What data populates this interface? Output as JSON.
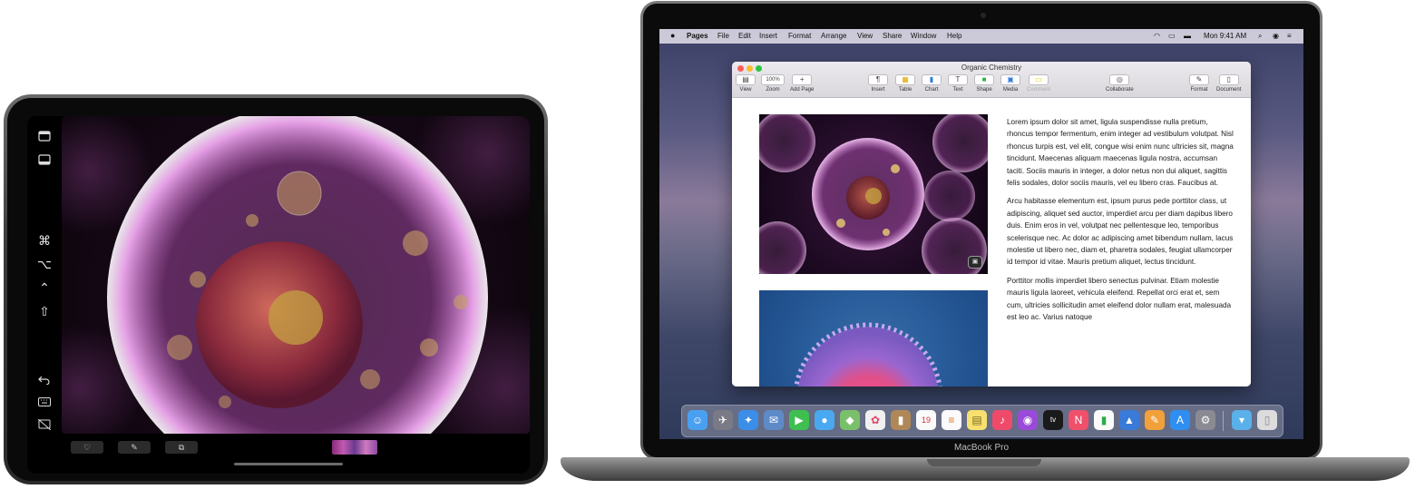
{
  "ipad": {
    "sidecar_buttons": [
      "⌘",
      "⌥",
      "⌃",
      "⇧"
    ],
    "touchbar_keys": [
      "♡",
      "✎",
      "⧉"
    ]
  },
  "mac": {
    "brand_label": "MacBook Pro",
    "menubar": {
      "app_name": "Pages",
      "items": [
        "File",
        "Edit",
        "Insert",
        "Format",
        "Arrange",
        "View",
        "Share",
        "Window",
        "Help"
      ],
      "clock": "Mon 9:41 AM"
    },
    "window": {
      "title": "Organic Chemistry",
      "zoom_value": "100%",
      "toolbar": [
        {
          "label": "View",
          "glyph": "▤"
        },
        {
          "label": "Zoom",
          "glyph": "100%"
        },
        {
          "label": "Add Page",
          "glyph": "+"
        },
        {
          "label": "Insert",
          "glyph": "¶"
        },
        {
          "label": "Table",
          "glyph": "▦"
        },
        {
          "label": "Chart",
          "glyph": "▮"
        },
        {
          "label": "Text",
          "glyph": "T"
        },
        {
          "label": "Shape",
          "glyph": "■"
        },
        {
          "label": "Media",
          "glyph": "▣"
        },
        {
          "label": "Comment",
          "glyph": "▭"
        },
        {
          "label": "Collaborate",
          "glyph": "◎"
        },
        {
          "label": "Format",
          "glyph": "✎"
        },
        {
          "label": "Document",
          "glyph": "▯"
        }
      ],
      "paragraphs": [
        "Lorem ipsum dolor sit amet, ligula suspendisse nulla pretium, rhoncus tempor fermentum, enim integer ad vestibulum volutpat. Nisl rhoncus turpis est, vel elit, congue wisi enim nunc ultricies sit, magna tincidunt. Maecenas aliquam maecenas ligula nostra, accumsan taciti. Sociis mauris in integer, a dolor netus non dui aliquet, sagittis felis sodales, dolor sociis mauris, vel eu libero cras. Faucibus at.",
        "Arcu habitasse elementum est, ipsum purus pede porttitor class, ut adipiscing, aliquet sed auctor, imperdiet arcu per diam dapibus libero duis. Enim eros in vel, volutpat nec pellentesque leo, temporibus scelerisque nec. Ac dolor ac adipiscing amet bibendum nullam, lacus molestie ut libero nec, diam et, pharetra sodales, feugiat ullamcorper id tempor id vitae. Mauris pretium aliquet, lectus tincidunt.",
        "Porttitor mollis imperdiet libero senectus pulvinar. Etiam molestie mauris ligula laoreet, vehicula eleifend. Repellat orci erat et, sem cum, ultricies sollicitudin amet eleifend dolor nullam erat, malesuada est leo ac. Varius natoque"
      ]
    },
    "dock_icons": [
      "finder-icon",
      "launchpad-icon",
      "safari-icon",
      "photos-browser-icon",
      "facetime-icon",
      "messages-icon",
      "maps-icon",
      "photos-icon",
      "contacts-icon",
      "calendar-icon",
      "reminders-icon",
      "notes-icon",
      "music-icon",
      "podcasts-icon",
      "tv-icon",
      "news-icon",
      "numbers-icon",
      "keynote-icon",
      "pages-icon",
      "app-store-icon",
      "system-preferences-icon",
      "downloads-folder-icon",
      "trash-icon"
    ]
  },
  "colors": {
    "accent_blue": "#3a7bd5",
    "cell_pink": "#d16cd0",
    "window_chrome": "#dcdade"
  }
}
